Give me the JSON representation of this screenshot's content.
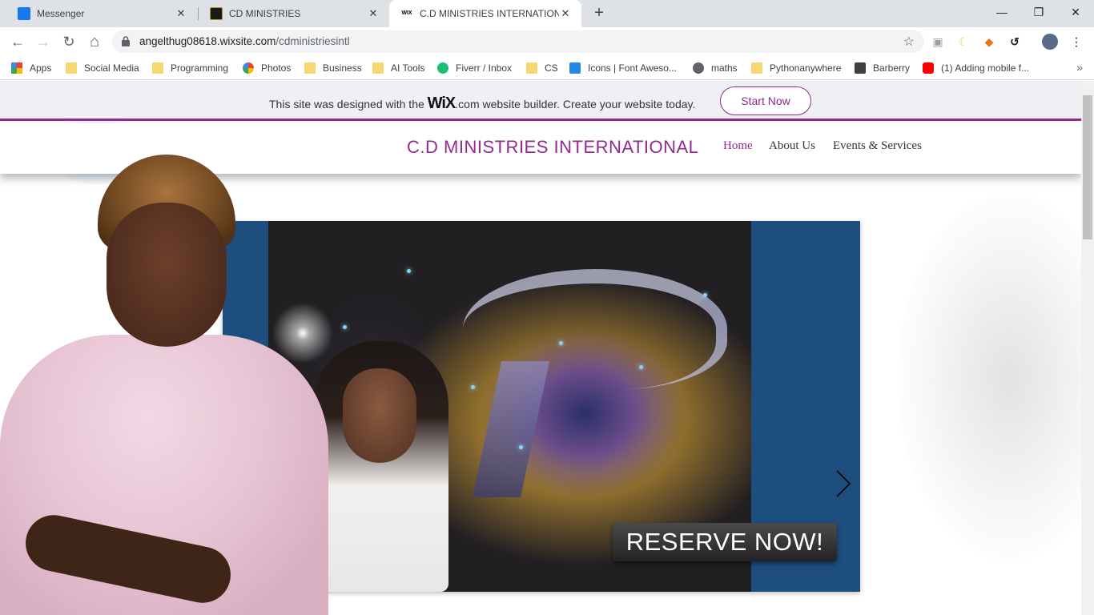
{
  "browser": {
    "tabs": [
      {
        "title": "Messenger",
        "favicon_color": "#1877f2"
      },
      {
        "title": "CD MINISTRIES",
        "favicon_color": "#1a1a1a"
      },
      {
        "title": "C.D MINISTRIES INTERNATIONAL",
        "favicon_color": "#000000"
      }
    ],
    "new_tab_symbol": "+",
    "window_controls": {
      "minimize": "—",
      "restore": "❐",
      "close": "✕"
    },
    "nav": {
      "back": "←",
      "forward": "→",
      "reload": "↻",
      "home": "⌂"
    },
    "url": {
      "host": "angelthug08618.wixsite.com",
      "path": "/cdministriesintl"
    },
    "bookmarks": [
      {
        "label": "Apps",
        "icon": "apps-grid-icon"
      },
      {
        "label": "Social Media",
        "icon": "folder-icon"
      },
      {
        "label": "Programming",
        "icon": "folder-icon"
      },
      {
        "label": "Photos",
        "icon": "photos-icon"
      },
      {
        "label": "Business",
        "icon": "folder-icon"
      },
      {
        "label": "AI Tools",
        "icon": "folder-icon"
      },
      {
        "label": "Fiverr / Inbox",
        "icon": "fiverr-icon"
      },
      {
        "label": "CS",
        "icon": "folder-icon"
      },
      {
        "label": "Icons | Font Aweso...",
        "icon": "flag-icon"
      },
      {
        "label": "maths",
        "icon": "globe-icon"
      },
      {
        "label": "Pythonanywhere",
        "icon": "folder-icon"
      },
      {
        "label": "Barberry",
        "icon": "barberry-icon"
      },
      {
        "label": "(1) Adding mobile f...",
        "icon": "youtube-icon"
      }
    ],
    "bookmarks_more": "»"
  },
  "wix_banner": {
    "text_before": "This site was designed with the",
    "wix_logo": "WiX",
    "text_after": ".com website builder. Create your website today.",
    "cta": "Start Now"
  },
  "site": {
    "brand": "C.D MINISTRIES INTERNATIONAL",
    "nav": [
      "Home",
      "About Us",
      "Events & Services"
    ],
    "active_nav": "Home"
  },
  "hero": {
    "reserve_label": "RESERVE NOW!",
    "next_icon": "chevron-right-icon",
    "panel_color": "#1e4e7e"
  },
  "colors": {
    "brand_purple": "#932b8f",
    "tab_strip": "#dee1e6"
  }
}
